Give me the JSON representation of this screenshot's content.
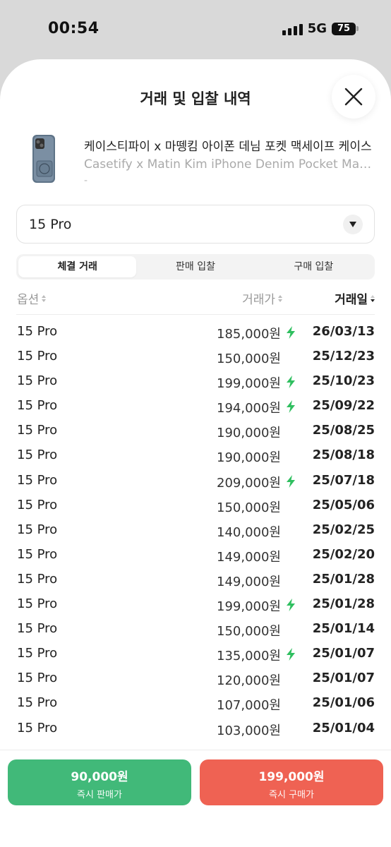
{
  "status_bar": {
    "time": "00:54",
    "network": "5G",
    "battery": "75"
  },
  "sheet": {
    "title": "거래 및 입찰 내역"
  },
  "product": {
    "title": "케이스티파이 x 마뗑킴 아이폰 데님 포켓 맥세이프 케이스",
    "subtitle": "Casetify x Matin Kim iPhone Denim Pocket MagSafe Case",
    "dash": "-"
  },
  "size_select": {
    "value": "15 Pro"
  },
  "tabs": [
    {
      "label": "체결 거래",
      "active": true
    },
    {
      "label": "판매 입찰",
      "active": false
    },
    {
      "label": "구매 입찰",
      "active": false
    }
  ],
  "table": {
    "headers": {
      "option": "옵션",
      "price": "거래가",
      "date": "거래일"
    },
    "rows": [
      {
        "option": "15 Pro",
        "price": "185,000원",
        "fast": true,
        "date": "26/03/13"
      },
      {
        "option": "15 Pro",
        "price": "150,000원",
        "fast": false,
        "date": "25/12/23"
      },
      {
        "option": "15 Pro",
        "price": "199,000원",
        "fast": true,
        "date": "25/10/23"
      },
      {
        "option": "15 Pro",
        "price": "194,000원",
        "fast": true,
        "date": "25/09/22"
      },
      {
        "option": "15 Pro",
        "price": "190,000원",
        "fast": false,
        "date": "25/08/25"
      },
      {
        "option": "15 Pro",
        "price": "190,000원",
        "fast": false,
        "date": "25/08/18"
      },
      {
        "option": "15 Pro",
        "price": "209,000원",
        "fast": true,
        "date": "25/07/18"
      },
      {
        "option": "15 Pro",
        "price": "150,000원",
        "fast": false,
        "date": "25/05/06"
      },
      {
        "option": "15 Pro",
        "price": "140,000원",
        "fast": false,
        "date": "25/02/25"
      },
      {
        "option": "15 Pro",
        "price": "149,000원",
        "fast": false,
        "date": "25/02/20"
      },
      {
        "option": "15 Pro",
        "price": "149,000원",
        "fast": false,
        "date": "25/01/28"
      },
      {
        "option": "15 Pro",
        "price": "199,000원",
        "fast": true,
        "date": "25/01/28"
      },
      {
        "option": "15 Pro",
        "price": "150,000원",
        "fast": false,
        "date": "25/01/14"
      },
      {
        "option": "15 Pro",
        "price": "135,000원",
        "fast": true,
        "date": "25/01/07"
      },
      {
        "option": "15 Pro",
        "price": "120,000원",
        "fast": false,
        "date": "25/01/07"
      },
      {
        "option": "15 Pro",
        "price": "107,000원",
        "fast": false,
        "date": "25/01/06"
      },
      {
        "option": "15 Pro",
        "price": "103,000원",
        "fast": false,
        "date": "25/01/04"
      }
    ]
  },
  "bottom": {
    "sell": {
      "price": "90,000원",
      "label": "즉시 판매가"
    },
    "buy": {
      "price": "199,000원",
      "label": "즉시 구매가"
    }
  },
  "colors": {
    "sell": "#41b979",
    "buy": "#ef6253",
    "fast_bolt": "#2fbf5f"
  },
  "icons": {
    "close": "close-icon",
    "dropdown": "triangle-down-icon",
    "fast": "lightning-bolt-icon",
    "sort": "sort-icon"
  }
}
